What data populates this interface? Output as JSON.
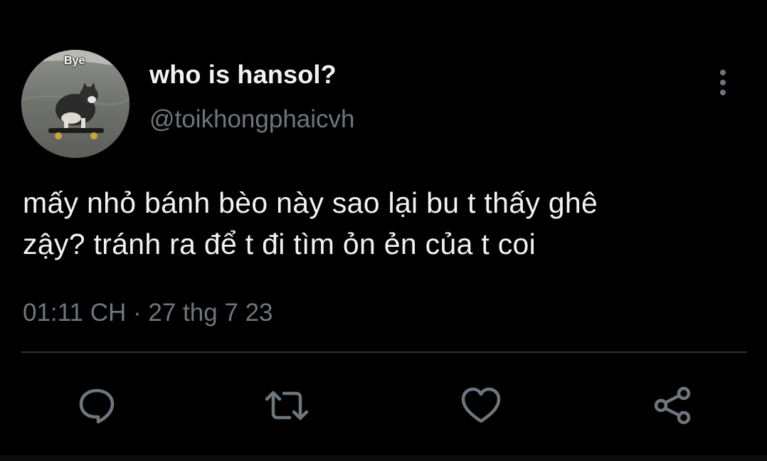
{
  "author": {
    "display_name": "who is hansol?",
    "handle": "@toikhongphaicvh",
    "avatar_caption": "Bye"
  },
  "tweet": {
    "lines": [
      "mấy nhỏ bánh bèo này sao lại bu t thấy ghê",
      "zậy? tránh ra để t đi tìm ỏn ẻn của t coi"
    ],
    "timestamp": "01:11 CH · 27 thg 7 23"
  },
  "actions": [
    {
      "icon": "reply-icon"
    },
    {
      "icon": "retweet-icon"
    },
    {
      "icon": "like-icon"
    },
    {
      "icon": "share-icon"
    }
  ],
  "colors": {
    "background": "#000000",
    "primary_text": "#f2f2f2",
    "secondary_text": "#6e767d",
    "divider": "#2f3336"
  }
}
